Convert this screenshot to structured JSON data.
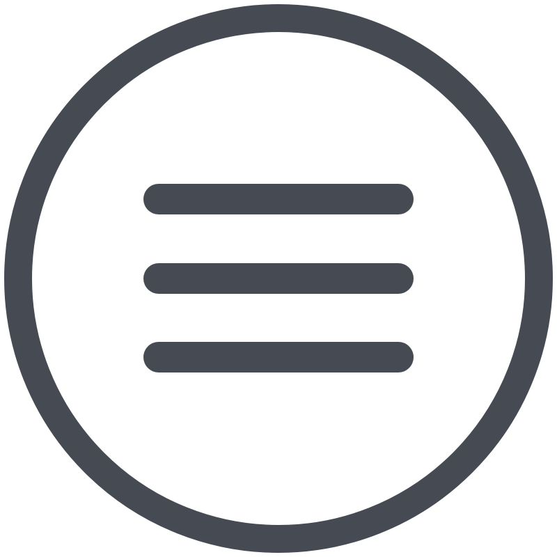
{
  "icon": {
    "name": "hamburger-menu-circle-icon",
    "color": "#454a53",
    "background": "#ffffff"
  }
}
